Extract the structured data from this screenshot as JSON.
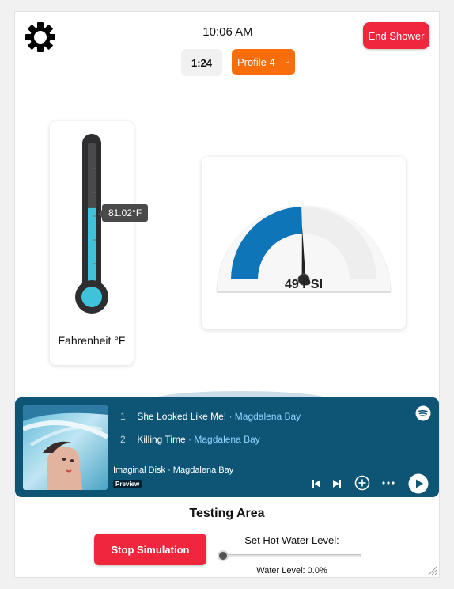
{
  "header": {
    "clock": "10:06 AM",
    "timer": "1:24",
    "profile_label": "Profile 4",
    "end_label": "End Shower"
  },
  "thermometer": {
    "value_label": "81.02°F",
    "unit_label": "Fahrenheit °F",
    "fill_fraction": 0.55,
    "fill_color": "#3ec3da"
  },
  "gauge": {
    "label": "49 PSI",
    "value": 49,
    "fill_color": "#0e75b8",
    "track_color": "#eeeeee"
  },
  "player": {
    "tracks": [
      {
        "num": "1",
        "title": "She Looked Like Me!",
        "artist": "Magdalena Bay"
      },
      {
        "num": "2",
        "title": "Killing Time",
        "artist": "Magdalena Bay"
      }
    ],
    "album_line": "Imaginal Disk · Magdalena Bay",
    "preview_badge": "Preview",
    "bg_color": "#0e5474",
    "artist_color": "#8fd2ff"
  },
  "testing": {
    "title": "Testing Area",
    "stop_label": "Stop Simulation",
    "hot_water_label": "Set Hot Water Level:",
    "water_level_label": "Water Level: 0.0%",
    "slider_fraction": 0.0
  },
  "icons": [
    "gear-icon",
    "chevron-down-icon",
    "spotify-icon",
    "prev-track-icon",
    "next-track-icon",
    "add-icon",
    "more-icon",
    "play-icon",
    "resize-handle-icon"
  ]
}
